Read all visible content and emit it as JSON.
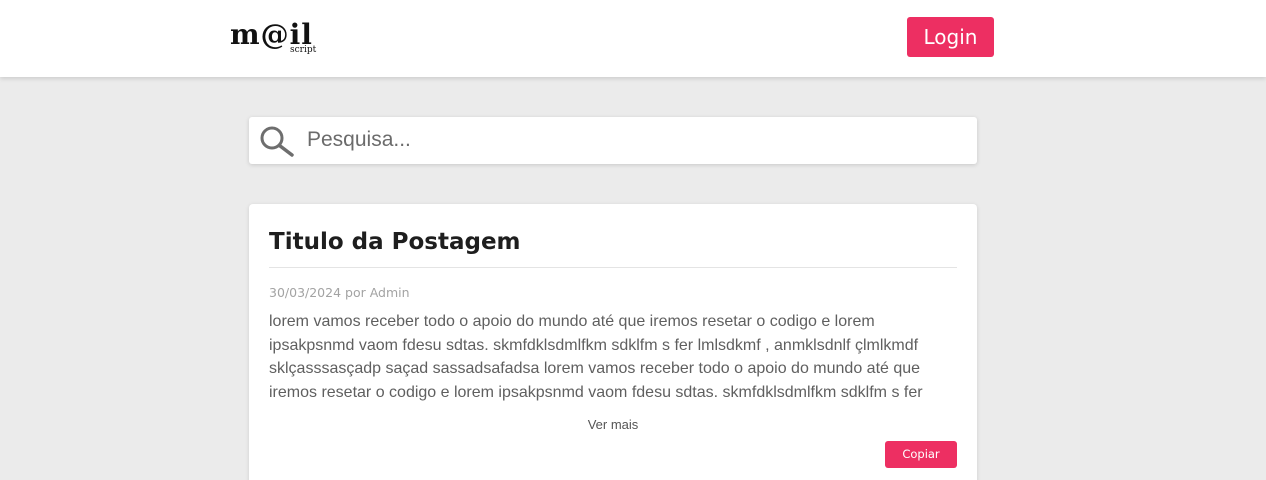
{
  "header": {
    "logo": {
      "main": "m@il",
      "sub": "script"
    },
    "login_label": "Login"
  },
  "search": {
    "placeholder": "Pesquisa...",
    "value": "",
    "icon": "search-icon"
  },
  "post": {
    "title": "Titulo da Postagem",
    "meta": "30/03/2024 por Admin",
    "body": "lorem vamos receber todo o apoio do mundo até que iremos resetar o codigo e lorem ipsakpsnmd vaom fdesu sdtas. skmfdklsdmlfkm sdklfm s fer lmlsdkmf , anmklsdnlf çlmlkmdf sklçasssasçadp saçad sassadsafadsa lorem vamos receber todo o apoio do mundo até que iremos resetar o codigo e lorem ipsakpsnmd vaom fdesu sdtas. skmfdklsdmlfkm sdklfm s fer",
    "see_more_label": "Ver mais",
    "copy_label": "Copiar"
  },
  "colors": {
    "accent": "#ed2f62",
    "background": "#ebebeb",
    "surface": "#ffffff"
  }
}
